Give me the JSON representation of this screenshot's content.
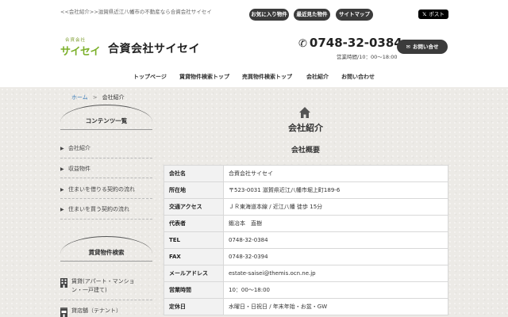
{
  "topbar": {
    "tagline": "<<会社紹介>>滋賀県近江八幡市の不動産なら合資会社サイセイ",
    "buttons": [
      "お気に入り物件",
      "最近見た物件",
      "サイトマップ"
    ],
    "xpost": {
      "glyph": "𝕏",
      "label": "ポスト"
    }
  },
  "header": {
    "logo_arc": "合資会社",
    "logo_mark": "サイセイ",
    "company_name": "合資会社サイセイ",
    "phone": "0748-32-0384",
    "hours": "営業時間/10：00～18:00",
    "contact_label": "お問い合せ"
  },
  "nav": [
    "トップページ",
    "賃貸物件検索トップ",
    "売買物件検索トップ",
    "会社紹介",
    "お問い合わせ"
  ],
  "breadcrumb": {
    "home": "ホーム",
    "sep": ">",
    "current": "会社紹介"
  },
  "sidebar": {
    "contents_title": "コンテンツ一覧",
    "contents": [
      "会社紹介",
      "収益物件",
      "住まいを借りる契約の流れ",
      "住まいを買う契約の流れ"
    ],
    "rental_title": "賃貸物件検索",
    "rental": [
      "賃貸(アパート・マンション・一戸建て)",
      "貸店舗（テナント）"
    ]
  },
  "main": {
    "title": "会社紹介",
    "subtitle": "会社概要",
    "rows": [
      {
        "k": "会社名",
        "v": "合資会社サイセイ"
      },
      {
        "k": "所在地",
        "v": "〒523-0031 滋賀県近江八幡市堀上町189-6"
      },
      {
        "k": "交通アクセス",
        "v": "ＪＲ東海道本線 / 近江八幡 徒歩 15分"
      },
      {
        "k": "代表者",
        "v": "鍛冶本　直樹"
      },
      {
        "k": "TEL",
        "v": "0748-32-0384"
      },
      {
        "k": "FAX",
        "v": "0748-32-0394"
      },
      {
        "k": "メールアドレス",
        "v": "estate-saisei@themis.ocn.ne.jp"
      },
      {
        "k": "営業時間",
        "v": "10：00～18:00"
      },
      {
        "k": "定休日",
        "v": "水曜日・日祝日 / 年末年始・お盆・GW"
      }
    ]
  },
  "colors": {
    "dark_button": "#3b3b3b",
    "logo_green": "#7bb02a",
    "logo_orange": "#e05a2a",
    "link_blue": "#3a7bb8"
  }
}
